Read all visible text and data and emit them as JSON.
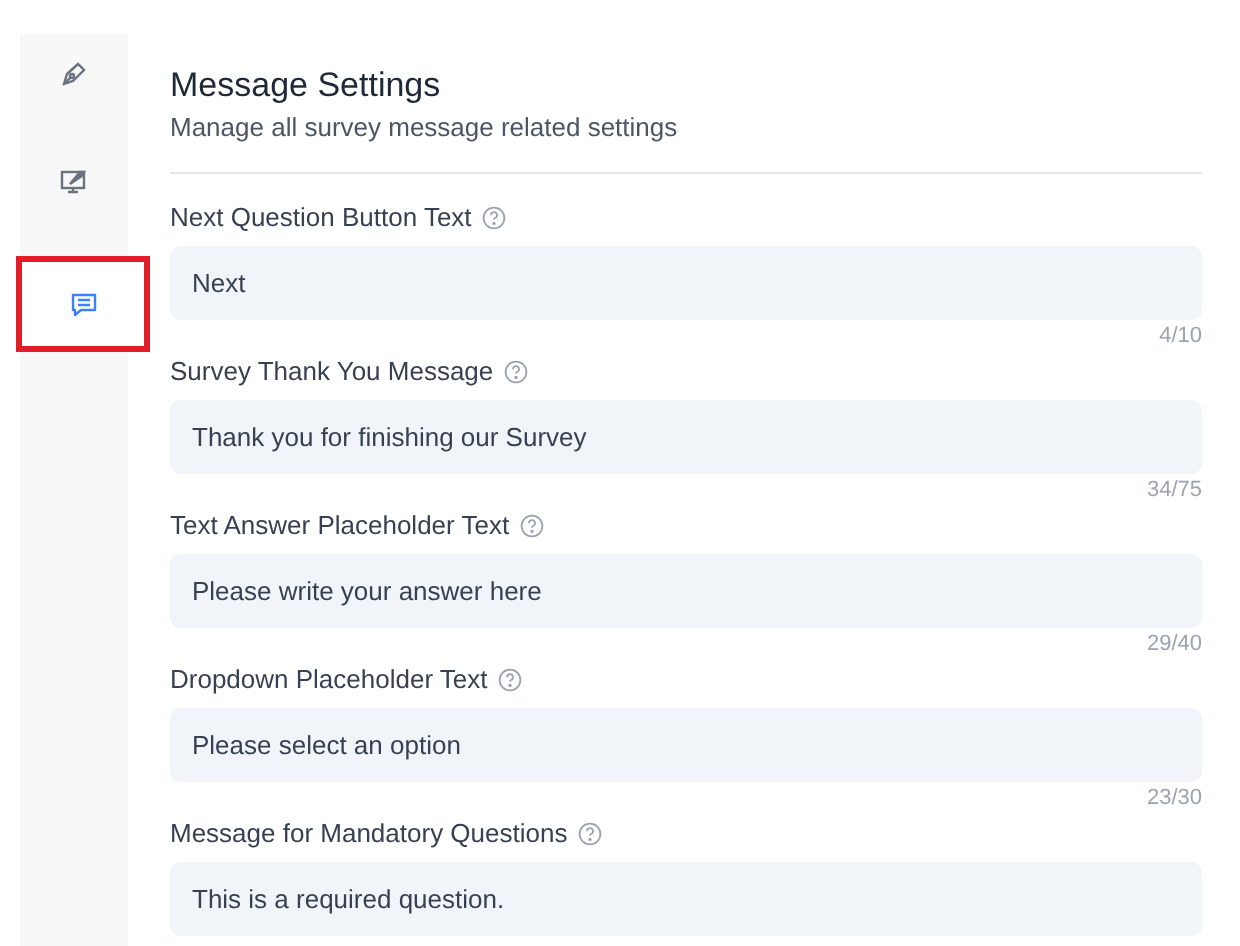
{
  "sidebar": {
    "items": [
      {
        "kind": "pen",
        "selected": false
      },
      {
        "kind": "monitor",
        "selected": false
      },
      {
        "kind": "message",
        "selected": true
      }
    ]
  },
  "header": {
    "title": "Message Settings",
    "subtitle": "Manage all survey message related settings"
  },
  "fields": [
    {
      "label": "Next Question Button Text",
      "value": "Next",
      "counter": "4/10"
    },
    {
      "label": "Survey Thank You Message",
      "value": "Thank you for finishing our Survey",
      "counter": "34/75"
    },
    {
      "label": "Text Answer Placeholder Text",
      "value": "Please write your answer here",
      "counter": "29/40"
    },
    {
      "label": "Dropdown Placeholder Text",
      "value": "Please select an option",
      "counter": "23/30"
    },
    {
      "label": "Message for Mandatory Questions",
      "value": "This is a required question."
    }
  ]
}
